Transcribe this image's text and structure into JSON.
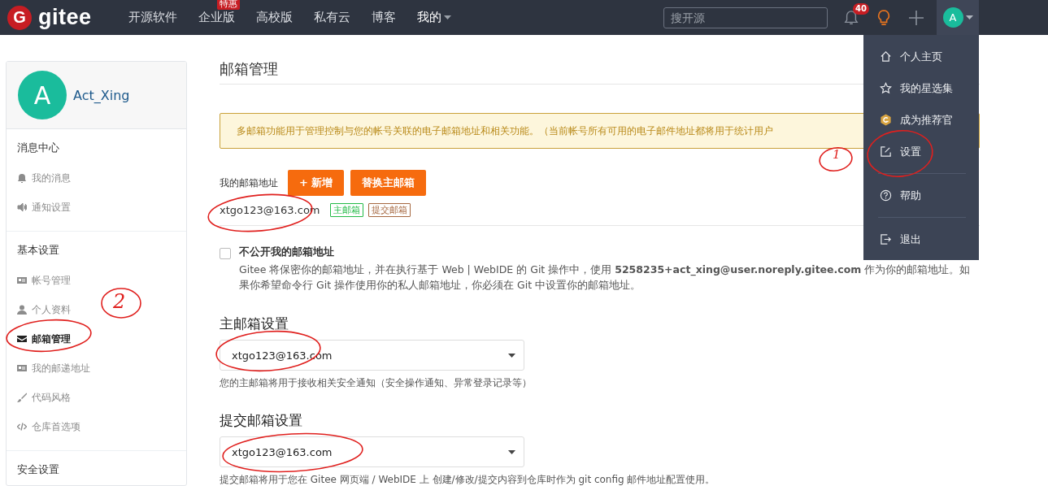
{
  "header": {
    "logo": {
      "mark": "G",
      "text": "gitee"
    },
    "nav": [
      {
        "label": "开源软件",
        "kind": "link"
      },
      {
        "label": "企业版",
        "kind": "link",
        "badge": "特惠"
      },
      {
        "label": "高校版",
        "kind": "link"
      },
      {
        "label": "私有云",
        "kind": "link"
      },
      {
        "label": "博客",
        "kind": "link"
      },
      {
        "label": "我的",
        "kind": "dropdown"
      }
    ],
    "search": {
      "placeholder": "搜开源"
    },
    "notifications": {
      "count": "40"
    },
    "avatar": {
      "initial": "A",
      "expanded": true
    }
  },
  "user_menu": {
    "items": [
      {
        "label": "个人主页"
      },
      {
        "label": "我的星选集"
      },
      {
        "label": "成为推荐官"
      },
      {
        "label": "设置"
      },
      {
        "label": "帮助"
      },
      {
        "label": "退出"
      }
    ]
  },
  "sidebar": {
    "profile": {
      "initial": "A",
      "name": "Act_Xing"
    },
    "sections": [
      {
        "title": "消息中心",
        "items": [
          {
            "label": "我的消息",
            "selected": false
          },
          {
            "label": "通知设置",
            "selected": false
          }
        ]
      },
      {
        "title": "基本设置",
        "items": [
          {
            "label": "帐号管理",
            "selected": false
          },
          {
            "label": "个人资料",
            "selected": false
          },
          {
            "label": "邮箱管理",
            "selected": true
          },
          {
            "label": "我的邮递地址",
            "selected": false
          },
          {
            "label": "代码风格",
            "selected": false
          },
          {
            "label": "仓库首选项",
            "selected": false
          }
        ]
      },
      {
        "title": "安全设置"
      }
    ]
  },
  "main": {
    "title": "邮箱管理",
    "alert": "多邮箱功能用于管理控制与您的帐号关联的电子邮箱地址和相关功能。（当前帐号所有可用的电子邮件地址都将用于统计用户",
    "addresses_label": "我的邮箱地址",
    "buttons": [
      "+ 新增",
      "替换主邮箱"
    ],
    "emails": [
      {
        "address": "xtgo123@163.com",
        "tags": [
          {
            "label": "主邮箱",
            "color": "#21ba45"
          },
          {
            "label": "提交邮箱",
            "color": "#a5673f"
          }
        ]
      }
    ],
    "privacy": {
      "label": "不公开我的邮箱地址",
      "checked": false,
      "description": "Gitee 将保密你的邮箱地址，并在执行基于 Web | WebIDE 的 Git 操作中，使用 **5258235+act_xing@user.noreply.gitee.com** 作为你的邮箱地址。如果你希望命令行 Git 操作使用你的私人邮箱地址，你必须在 Git 中设置你的邮箱地址。"
    },
    "settings": [
      {
        "title": "主邮箱设置",
        "value": "xtgo123@163.com",
        "help": "您的主邮箱将用于接收相关安全通知（安全操作通知、异常登录记录等）"
      },
      {
        "title": "提交邮箱设置",
        "value": "xtgo123@163.com",
        "help": "提交邮箱将用于您在 Gitee 网页端 / WebIDE 上 创建/修改/提交内容到仓库时作为 git config 邮件地址配置使用。"
      }
    ]
  },
  "annotations": [
    {
      "kind": "number",
      "text": "1"
    },
    {
      "kind": "number",
      "text": "2"
    }
  ]
}
